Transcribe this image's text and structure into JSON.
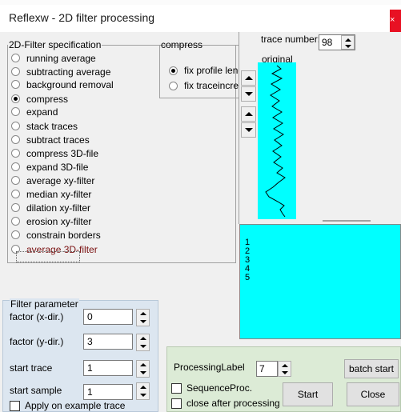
{
  "window": {
    "title": "Reflexw - 2D filter processing",
    "close_glyph": "×"
  },
  "spec": {
    "legend": "2D-Filter specification",
    "options": [
      {
        "label": "running average",
        "checked": false
      },
      {
        "label": "subtracting average",
        "checked": false
      },
      {
        "label": "background removal",
        "checked": false
      },
      {
        "label": "compress",
        "checked": true
      },
      {
        "label": "expand",
        "checked": false
      },
      {
        "label": "stack traces",
        "checked": false
      },
      {
        "label": "subtract traces",
        "checked": false
      },
      {
        "label": "compress 3D-file",
        "checked": false
      },
      {
        "label": "expand 3D-file",
        "checked": false
      },
      {
        "label": "average xy-filter",
        "checked": false
      },
      {
        "label": "median xy-filter",
        "checked": false
      },
      {
        "label": "dilation xy-filter",
        "checked": false
      },
      {
        "label": "erosion xy-filter",
        "checked": false
      },
      {
        "label": "constrain borders",
        "checked": false
      },
      {
        "label": "average 3D-filter",
        "checked": false
      }
    ]
  },
  "compress": {
    "legend": "compress",
    "options": [
      {
        "label": "fix profile length",
        "checked": true
      },
      {
        "label": "fix traceincrement",
        "checked": false
      }
    ]
  },
  "trace": {
    "number_label": "trace number:",
    "number_value": "98",
    "original_label": "original",
    "canvas_color": "#00ffff"
  },
  "list": {
    "items": [
      "1",
      "2",
      "3",
      "4",
      "5"
    ]
  },
  "filter": {
    "legend": "Filter parameter",
    "fields": [
      {
        "label": "factor (x-dir.)",
        "value": "0"
      },
      {
        "label": "factor (y-dir.)",
        "value": "3"
      },
      {
        "label": "start trace",
        "value": "1"
      },
      {
        "label": "start sample",
        "value": "1"
      }
    ],
    "apply_label": "Apply on example trace"
  },
  "processing": {
    "label": "ProcessingLabel",
    "value": "7",
    "batch_start": "batch start",
    "sequence_label": "SequenceProc.",
    "close_after_label": "close after processing",
    "start": "Start",
    "close": "Close"
  },
  "colors": {
    "cyan": "#00ffff",
    "filter_panel": "#dce6f0",
    "processing_panel": "#dcebd6",
    "highlight_text": "#7a1010"
  }
}
